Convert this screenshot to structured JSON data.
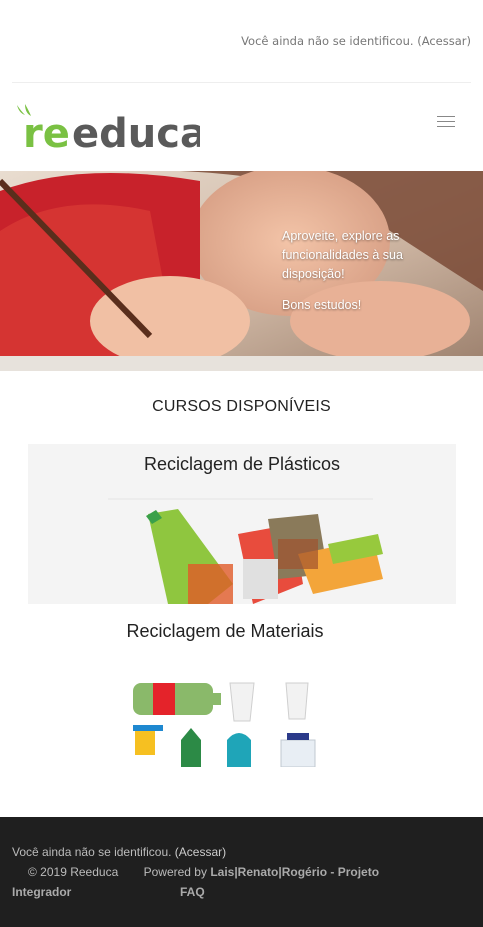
{
  "topbar": {
    "login_text": "Você ainda não se identificou.",
    "login_link": "(Acessar)"
  },
  "brand": {
    "name": "reeduca",
    "colors": {
      "green": "#7ac143",
      "gray": "#5a5a5a"
    }
  },
  "header": {
    "menu_icon": "hamburger-icon"
  },
  "hero": {
    "line1": "Aproveite, explore as funcionalidades à sua disposição!",
    "line2": "Bons estudos!"
  },
  "courses": {
    "title": "CURSOS DISPONÍVEIS",
    "items": [
      {
        "label": "Reciclagem de Plásticos"
      },
      {
        "label": "Reciclagem de Materiais"
      }
    ]
  },
  "footer": {
    "login_text": "Você ainda não se identificou.",
    "login_link": "(Acessar)",
    "copyright": "© 2019 Reeduca",
    "powered": "Powered by",
    "authors": "Lais|Renato|Rogério - Projeto",
    "project": "Integrador",
    "faq": "FAQ"
  }
}
